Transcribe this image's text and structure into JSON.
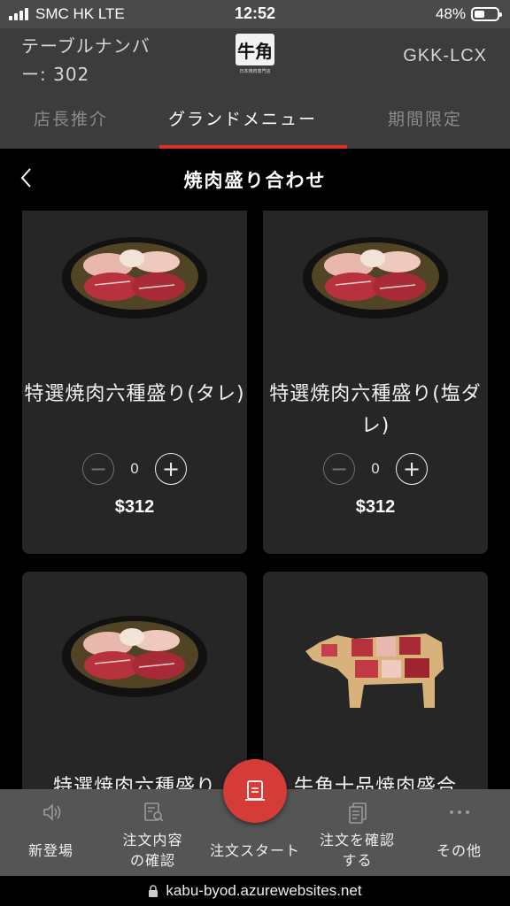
{
  "status_bar": {
    "carrier": "SMC HK  LTE",
    "time": "12:52",
    "battery_pct": "48%"
  },
  "header": {
    "table_label": "テーブルナンバー: 302",
    "logo_text": "牛角",
    "logo_subtext": "日本焼肉専門店",
    "device_code": "GKK-LCX",
    "tabs": [
      {
        "label": "店長推介",
        "active": false
      },
      {
        "label": "グランドメニュー",
        "active": true
      },
      {
        "label": "期間限定",
        "active": false
      }
    ]
  },
  "category": {
    "title": "焼肉盛り合わせ"
  },
  "items": [
    {
      "name": "特選焼肉六種盛り(タレ)",
      "qty": "0",
      "price": "$312",
      "image": "meat-platter-image"
    },
    {
      "name": "特選焼肉六種盛り(塩ダレ)",
      "qty": "0",
      "price": "$312",
      "image": "meat-platter-image"
    },
    {
      "name": "特選焼肉六種盛り",
      "image": "meat-platter-image"
    },
    {
      "name": "牛角十品焼肉盛合",
      "image": "cow-board-platter-image"
    }
  ],
  "bottom_nav": {
    "items": [
      {
        "label": "新登場",
        "icon": "speaker-icon"
      },
      {
        "label": "注文内容の確認",
        "icon": "order-search-icon"
      },
      {
        "label": "注文スタート",
        "icon": "order-start-icon"
      },
      {
        "label": "注文を確認する",
        "icon": "documents-icon"
      },
      {
        "label": "その他",
        "icon": "more-icon"
      }
    ]
  },
  "url_bar": {
    "url": "kabu-byod.azurewebsites.net"
  },
  "colors": {
    "accent": "#d9302a",
    "header_bg": "#3c3c3c",
    "card_bg": "#262626",
    "nav_bg": "#555555"
  }
}
